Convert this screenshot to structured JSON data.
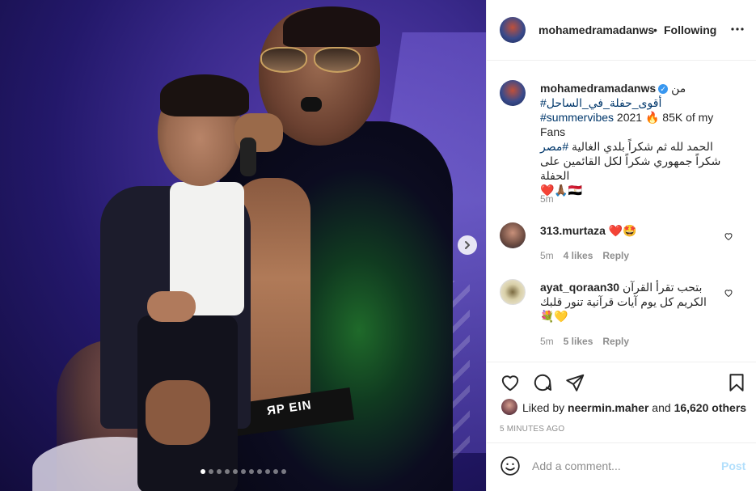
{
  "post": {
    "image_alt": "",
    "carousel": {
      "slide_count": 11,
      "active_index": 0
    }
  },
  "header": {
    "username": "mohamedramadanws",
    "separator": "•",
    "follow_label": "Following"
  },
  "caption": {
    "username": "mohamedramadanws",
    "line_ar_1": "من",
    "hashtag_ar": "#أقوى_حفلة_في_الساحل",
    "hashtag_en": "#summervibes",
    "text_1": " 2021 🔥 85K of my Fans",
    "line_ar_2_pre": "الحمد لله ثم شكراً بلدي الغالية ",
    "hashtag_ar_2": "#مصر",
    "line_ar_2_post": " شكراً جمهوري شكراً لكل القائمين على الحفلة",
    "emoji_line": "❤️🙏🏾🇪🇬",
    "time": "5m"
  },
  "comments": [
    {
      "username": "313.murtaza",
      "text": " ❤️🤩",
      "time": "5m",
      "likes": "4 likes",
      "reply_label": "Reply"
    },
    {
      "username": "ayat_qoraan30",
      "text": " بتحب تقرأ القرآن الكريم كل يوم آيات قرآنية تنور قلبك",
      "text_2": "💐💛",
      "time": "5m",
      "likes": "5 likes",
      "reply_label": "Reply"
    }
  ],
  "likes": {
    "prefix": "Liked by ",
    "user": "neermin.maher",
    "middle": " and ",
    "count": "16,620 others"
  },
  "timestamp": "5 MINUTES AGO",
  "add_comment": {
    "placeholder": "Add a comment...",
    "post_label": "Post"
  }
}
